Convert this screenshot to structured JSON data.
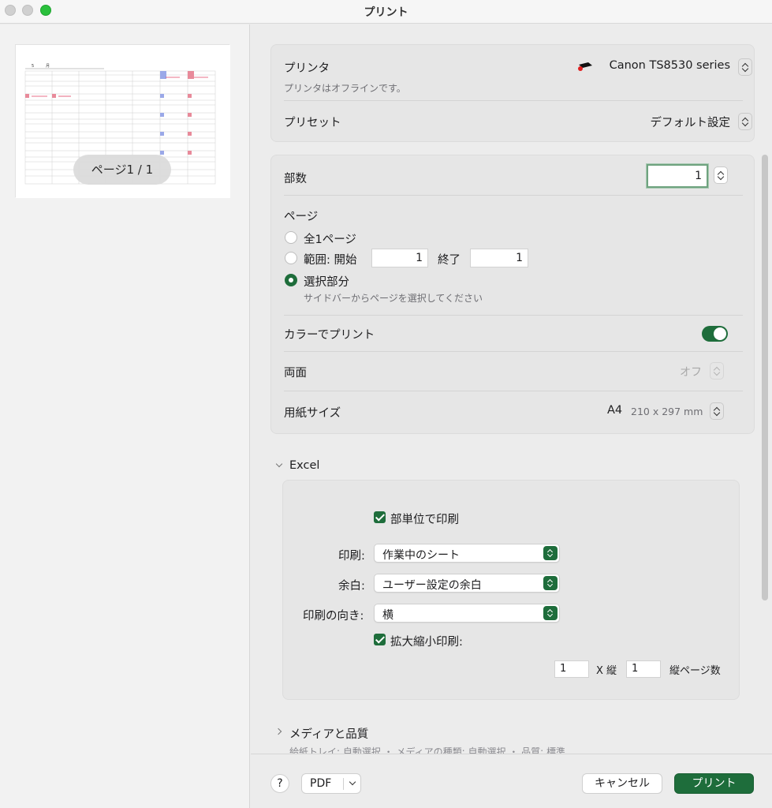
{
  "window": {
    "title": "プリント"
  },
  "sidebar": {
    "page_indicator": "ページ1 / 1"
  },
  "printer_section": {
    "printer_label": "プリンタ",
    "printer_name": "Canon TS8530 series",
    "printer_status": "プリンタはオフラインです。",
    "printer_icon": "printer-icon",
    "preset_label": "プリセット",
    "preset_value": "デフォルト設定"
  },
  "options": {
    "copies_label": "部数",
    "copies_value": "1",
    "pages_label": "ページ",
    "pages_all_label": "全1ページ",
    "pages_range_label": "範囲: 開始",
    "pages_range_from": "1",
    "pages_range_to_label": "終了",
    "pages_range_to": "1",
    "pages_selection_label": "選択部分",
    "pages_selection_hint": "サイドバーからページを選択してください",
    "selected_option": "選択部分",
    "color_label": "カラーでプリント",
    "color_on": true,
    "duplex_label": "両面",
    "duplex_value": "オフ",
    "paper_label": "用紙サイズ",
    "paper_value": "A4",
    "paper_dims": "210 x 297 mm"
  },
  "excel": {
    "section_label": "Excel",
    "collate_label": "部単位で印刷",
    "print_label": "印刷:",
    "print_value": "作業中のシート",
    "margin_label": "余白:",
    "margin_value": "ユーザー設定の余白",
    "orientation_label": "印刷の向き:",
    "orientation_value": "横",
    "scale_label": "拡大縮小印刷:",
    "scale_horizontal": "1",
    "scale_x_label": "X 縦",
    "scale_vertical": "1",
    "scale_pages_label": "縦ページ数"
  },
  "media": {
    "section_label": "メディアと品質",
    "summary": "給紙トレイ: 自動選択 ・ メディアの種類: 自動選択 ・ 品質: 標準"
  },
  "footer": {
    "help_label": "?",
    "pdf_label": "PDF",
    "cancel_label": "キャンセル",
    "print_label": "プリント"
  },
  "colors": {
    "accent": "#1e6d3b",
    "close": "#d0d0d0",
    "maximize": "#2ac03c"
  }
}
